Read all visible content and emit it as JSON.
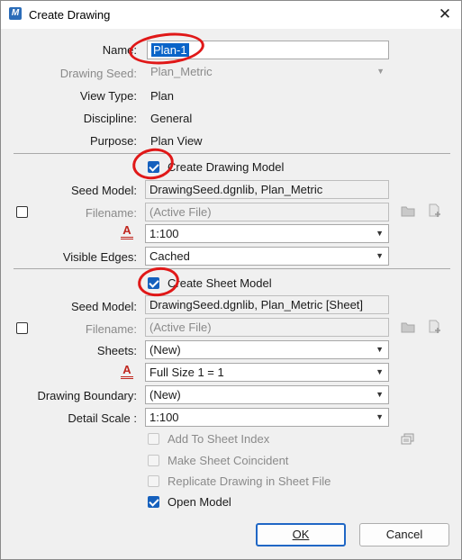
{
  "window": {
    "title": "Create Drawing",
    "app_icon_glyph": "M",
    "close_glyph": "✕"
  },
  "fields": {
    "name_label": "Name:",
    "name_value": "Plan-1",
    "drawing_seed_label": "Drawing Seed:",
    "drawing_seed_value": "Plan_Metric",
    "view_type_label": "View Type:",
    "view_type_value": "Plan",
    "discipline_label": "Discipline:",
    "discipline_value": "General",
    "purpose_label": "Purpose:",
    "purpose_value": "Plan View"
  },
  "drawing_model": {
    "checkbox_label": "Create Drawing Model",
    "checked": true,
    "seed_model_label": "Seed Model:",
    "seed_model_value": "DrawingSeed.dgnlib, Plan_Metric",
    "filename_label": "Filename:",
    "filename_value": "(Active File)",
    "scale_value": "1:100",
    "visible_edges_label": "Visible Edges:",
    "visible_edges_value": "Cached"
  },
  "sheet_model": {
    "checkbox_label": "Create Sheet Model",
    "checked": true,
    "seed_model_label": "Seed Model:",
    "seed_model_value": "DrawingSeed.dgnlib, Plan_Metric [Sheet]",
    "filename_label": "Filename:",
    "filename_value": "(Active File)",
    "sheets_label": "Sheets:",
    "sheets_value": "(New)",
    "annotation_scale_value": "Full Size 1 = 1",
    "drawing_boundary_label": "Drawing Boundary:",
    "drawing_boundary_value": "(New)",
    "detail_scale_label": "Detail Scale :",
    "detail_scale_value": "1:100"
  },
  "options": {
    "add_to_sheet_index": "Add To Sheet Index",
    "make_sheet_coincident": "Make Sheet Coincident",
    "replicate_drawing": "Replicate Drawing in Sheet File",
    "open_model": "Open Model"
  },
  "buttons": {
    "ok": "OK",
    "cancel": "Cancel"
  },
  "icons": {
    "annotation_scale_glyph": "A",
    "dropdown_arrow": "▼",
    "annotation_color": "#c0261e",
    "accent": "#1560bd",
    "highlight_circle": "#e01818"
  }
}
